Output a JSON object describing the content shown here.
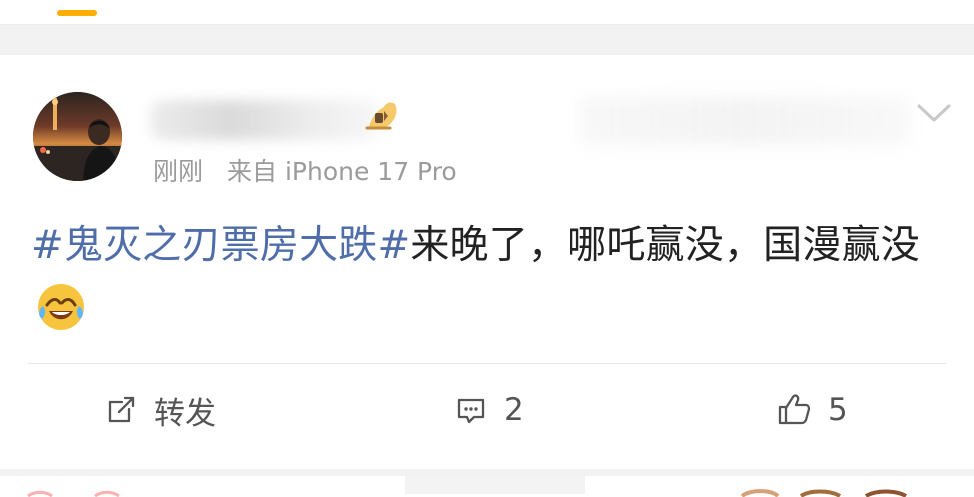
{
  "post": {
    "timestamp": "刚刚",
    "source": "来自 iPhone 17 Pro",
    "hashtag": "#鬼灭之刃票房大跌#",
    "body": "来晚了，哪吒赢没，国漫赢没"
  },
  "actions": {
    "repost_label": "转发",
    "comment_count": "2",
    "like_count": "5"
  },
  "icons": {
    "options": "chevron-down-icon",
    "repost": "repost-icon",
    "comment": "comment-icon",
    "like": "thumbs-up-icon",
    "emoji": "laughing-tears-emoji"
  },
  "colors": {
    "accent": "#ffae00",
    "hashtag": "#4f6ea9",
    "meta": "#9b9b9b",
    "text": "#222222",
    "action": "#555555",
    "background_band": "#f2f2f2"
  }
}
